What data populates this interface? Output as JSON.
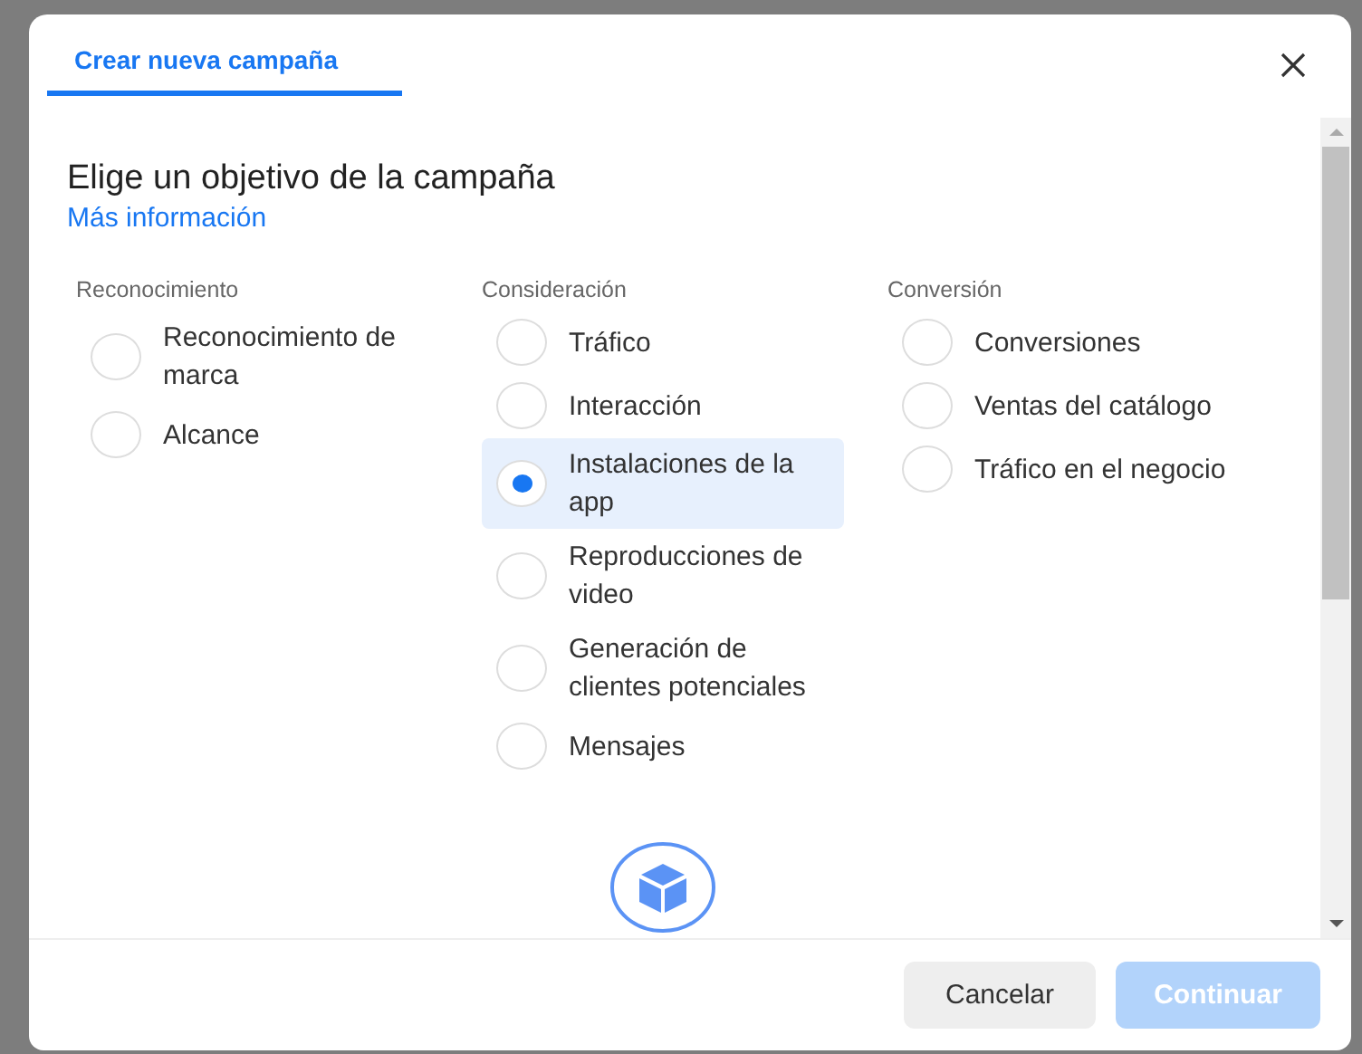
{
  "dialog": {
    "tab": {
      "label": "Crear nueva campaña",
      "selected": true
    },
    "heading": "Elige un objetivo de la campaña",
    "link": "Más información",
    "groups": [
      {
        "label": "Reconocimiento",
        "options": [
          {
            "label": "Reconocimiento de marca",
            "selected": false
          },
          {
            "label": "Alcance",
            "selected": false
          }
        ]
      },
      {
        "label": "Consideración",
        "options": [
          {
            "label": "Tráfico",
            "selected": false
          },
          {
            "label": "Interacción",
            "selected": false
          },
          {
            "label": "Instalaciones de la app",
            "selected": true
          },
          {
            "label": "Reproducciones de video",
            "selected": false
          },
          {
            "label": "Generación de clientes potenciales",
            "selected": false
          },
          {
            "label": "Mensajes",
            "selected": false
          }
        ]
      },
      {
        "label": "Conversión",
        "options": [
          {
            "label": "Conversiones",
            "selected": false
          },
          {
            "label": "Ventas del catálogo",
            "selected": false
          },
          {
            "label": "Tráfico en el negocio",
            "selected": false
          }
        ]
      }
    ],
    "buttons": [
      {
        "label": "Cancelar",
        "kind": "secondary",
        "disabled": false
      },
      {
        "label": "Continuar",
        "kind": "primary",
        "disabled": true
      }
    ]
  }
}
